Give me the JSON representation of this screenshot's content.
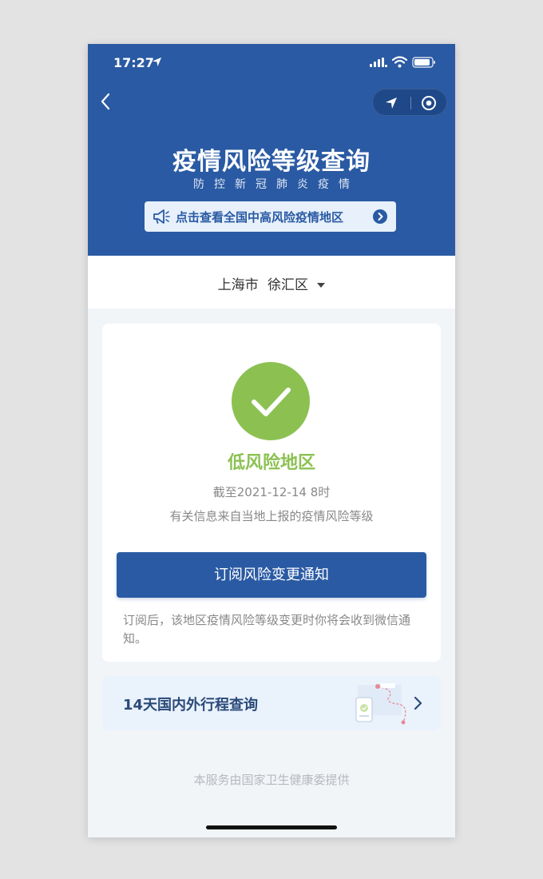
{
  "status_bar": {
    "time": "17:27"
  },
  "header": {
    "title": "疫情风险等级查询",
    "subtitle": "防控新冠肺炎疫情",
    "banner_label": "点击查看全国中高风险疫情地区"
  },
  "location": {
    "city": "上海市",
    "district": "徐汇区"
  },
  "risk_card": {
    "level": "低风险地区",
    "as_of": "截至2021-12-14 8时",
    "source_note": "有关信息来自当地上报的疫情风险等级",
    "subscribe_button": "订阅风险变更通知",
    "subscribe_note": "订阅后，该地区疫情风险等级变更时你将会收到微信通知。"
  },
  "itinerary": {
    "label": "14天国内外行程查询"
  },
  "footer": {
    "text": "本服务由国家卫生健康委提供"
  },
  "colors": {
    "header_blue": "#2a5aa3",
    "low_risk_green": "#8cc152",
    "background": "#f2f5f8"
  },
  "icons": [
    "location-arrow-icon",
    "signal-icon",
    "wifi-icon",
    "battery-icon",
    "back-icon",
    "location-icon",
    "target-icon",
    "megaphone-icon",
    "chevron-right-icon",
    "check-icon",
    "map-route-icon"
  ]
}
